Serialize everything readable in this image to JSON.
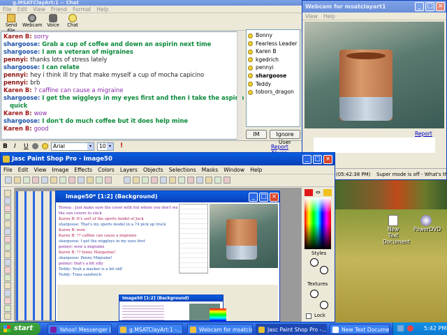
{
  "chat": {
    "title": "g.MSATClayArt:1 -- Chat",
    "menu": [
      "File",
      "Edit",
      "View",
      "Friend",
      "Format",
      "Help"
    ],
    "toolbar": [
      "Send File",
      "Webcam",
      "Voice",
      "Chat"
    ],
    "messages": [
      {
        "who": "Karen B:",
        "text": "sorry",
        "c": "#a01a1a",
        "tc": "#8a2aa8"
      },
      {
        "who": "shargoose:",
        "text": "Grab a cup of coffee and down an aspirin next time",
        "c": "#1a50a8",
        "tc": "#0a8a3a"
      },
      {
        "who": "shargoose:",
        "text": "I am a veteran of migraines",
        "c": "#1a50a8",
        "tc": "#0a8a3a"
      },
      {
        "who": "pennyi:",
        "text": "thanks lots of stress lately",
        "c": "#8a1010",
        "tc": "#222"
      },
      {
        "who": "shargoose:",
        "text": "I can relate",
        "c": "#1a50a8",
        "tc": "#0a8a3a"
      },
      {
        "who": "pennyi:",
        "text": "hey i think ill try that make myself a cup of mocha capicino",
        "c": "#8a1010",
        "tc": "#222"
      },
      {
        "who": "pennyi:",
        "text": "brb",
        "c": "#8a1010",
        "tc": "#222"
      },
      {
        "who": "Karen B:",
        "text": "? caffine can cause a migraine",
        "c": "#a01a1a",
        "tc": "#8a2aa8"
      },
      {
        "who": "shargoose:",
        "text": "I get the wiggleys in my eyes first and then I take the aspirin and coffee",
        "c": "#1a50a8",
        "tc": "#0a8a3a"
      },
      {
        "who": "",
        "text": "quick",
        "c": "#1a50a8",
        "tc": "#0a8a3a"
      },
      {
        "who": "Karen B:",
        "text": "wow",
        "c": "#a01a1a",
        "tc": "#8a2aa8"
      },
      {
        "who": "shargoose:",
        "text": "I don't do much coffee but it does help mine",
        "c": "#1a50a8",
        "tc": "#0a8a3a"
      },
      {
        "who": "Karen B:",
        "text": "good",
        "c": "#a01a1a",
        "tc": "#8a2aa8"
      }
    ],
    "buddies": [
      "Bonny",
      "Fearless Leader",
      "Karen B",
      "kgedrich",
      "pennyi",
      "shargoose",
      "Teddy",
      "tobors_dragon"
    ],
    "im": "IM",
    "ignore": "Ignore User",
    "font": "Arial",
    "size": "10",
    "report": "Report Abuse",
    "fmt": [
      "B",
      "I",
      "U"
    ]
  },
  "webcam": {
    "title": "Webcam for msatclayart1",
    "menu": [
      "View",
      "Help"
    ],
    "report": "Report Abuse",
    "time": "(05:42:38 PM)",
    "super": "Super mode is off - What's this?"
  },
  "psp": {
    "title": "Jasc Paint Shop Pro - Image50",
    "menu": [
      "File",
      "Edit",
      "View",
      "Image",
      "Effects",
      "Colors",
      "Layers",
      "Objects",
      "Selections",
      "Masks",
      "Window",
      "Help"
    ],
    "image": "Image50* [1:2] (Background)",
    "styles": "Styles",
    "textures": "Textures",
    "lock": "Lock",
    "inner": [
      "Teresa : Just make sure the cover with foil where you don't want",
      "the sun covers to stick",
      "Karen B: It's sort of the sports model of Jack",
      "shargoose: That's my sports model in a 74 pick up truck",
      "Karen B: wow",
      "Karen B: ?? caffine can cause a migraine",
      "shargoose: I get the wiggleys in my eyes first",
      "pennyi: wow a migraine",
      "Karen B: ?? funny Margarine!",
      "shargoose: Penny Migraine!",
      "pennyi: that's a bit silly",
      "Teddy: Yeah a marker is a bit old!",
      "Teddy: Tuna sandwich"
    ],
    "inner2": "Image50 [1:2] (Background)"
  },
  "desktop": [
    {
      "label": "New Text Document"
    },
    {
      "label": "PowerDVD"
    }
  ],
  "taskbar": {
    "start": "start",
    "items": [
      "Yahoo! Messenger (I...",
      "g.MSATClayArt:1 -...",
      "Webcam for msatclay...",
      "Jasc Paint Shop Pro -...",
      "New Text Document ..."
    ],
    "clock": "5:42 PM"
  }
}
